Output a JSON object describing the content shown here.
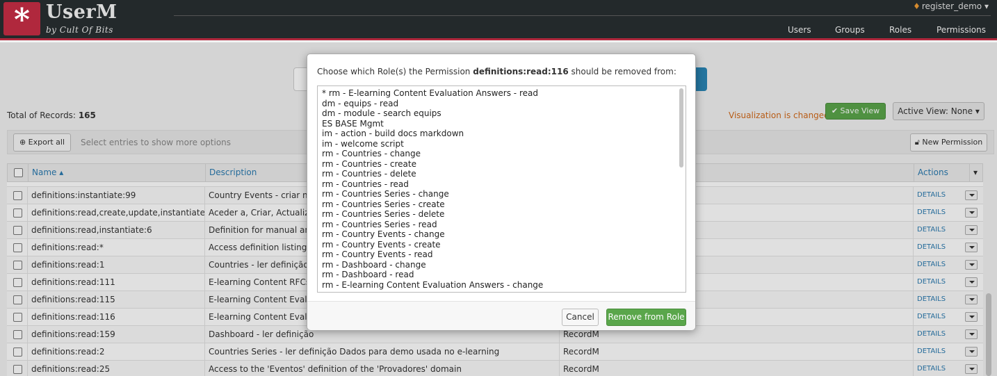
{
  "app": {
    "title": "UserM",
    "subtitle": "by Cult Of Bits",
    "logo_glyph": "*"
  },
  "user_menu": {
    "label": "register_demo",
    "icon": "flame-icon"
  },
  "nav": [
    "Users",
    "Groups",
    "Roles",
    "Permissions"
  ],
  "toolbar": {
    "total_label": "Total of Records:",
    "total_value": "165",
    "visualization_status": "Visualization is changed",
    "save_view": "Save View",
    "active_view": "Active View: None",
    "export_all": "Export all",
    "select_hint": "Select entries to show more options",
    "new_permission": "New Permission"
  },
  "table": {
    "columns": [
      "Name",
      "Description",
      "Actions"
    ],
    "details_label": "DETAILS",
    "rows": [
      {
        "name": "definitions:instantiate:99",
        "description": "Country Events - criar nov",
        "app": ""
      },
      {
        "name": "definitions:read,create,update,instantiate,...",
        "description": "Aceder a, Criar, Actualizar",
        "app": ""
      },
      {
        "name": "definitions:read,instantiate:6",
        "description": "Definition for manual and",
        "app": ""
      },
      {
        "name": "definitions:read:*",
        "description": "Access definition listings -",
        "app": ""
      },
      {
        "name": "definitions:read:1",
        "description": "Countries - ler definição D",
        "app": ""
      },
      {
        "name": "definitions:read:111",
        "description": "E-learning Content RFCs -",
        "app": ""
      },
      {
        "name": "definitions:read:115",
        "description": "E-learning Content Evalua",
        "app": ""
      },
      {
        "name": "definitions:read:116",
        "description": "E-learning Content Evalua",
        "app": ""
      },
      {
        "name": "definitions:read:159",
        "description": "Dashboard - ler definição",
        "app": "RecordM"
      },
      {
        "name": "definitions:read:2",
        "description": "Countries Series - ler definição Dados para demo usada no e-learning",
        "app": "RecordM"
      },
      {
        "name": "definitions:read:25",
        "description": "Access to the 'Eventos' definition of the 'Provadores' domain",
        "app": "RecordM"
      }
    ]
  },
  "modal": {
    "title_prefix": "Choose which Role(s) the Permission",
    "permission": "definitions:read:116",
    "title_suffix": "should be removed from:",
    "roles": [
      "* rm - E-learning Content Evaluation Answers - read",
      "dm - equips - read",
      "dm - module - search equips",
      "ES BASE Mgmt",
      "im - action - build docs markdown",
      "im - welcome script",
      "rm - Countries - change",
      "rm - Countries - create",
      "rm - Countries - delete",
      "rm - Countries - read",
      "rm - Countries Series - change",
      "rm - Countries Series - create",
      "rm - Countries Series - delete",
      "rm - Countries Series - read",
      "rm - Country Events - change",
      "rm - Country Events - create",
      "rm - Country Events - read",
      "rm - Dashboard - change",
      "rm - Dashboard - read",
      "rm - E-learning Content Evaluation Answers - change"
    ],
    "cancel": "Cancel",
    "remove": "Remove from Role"
  }
}
